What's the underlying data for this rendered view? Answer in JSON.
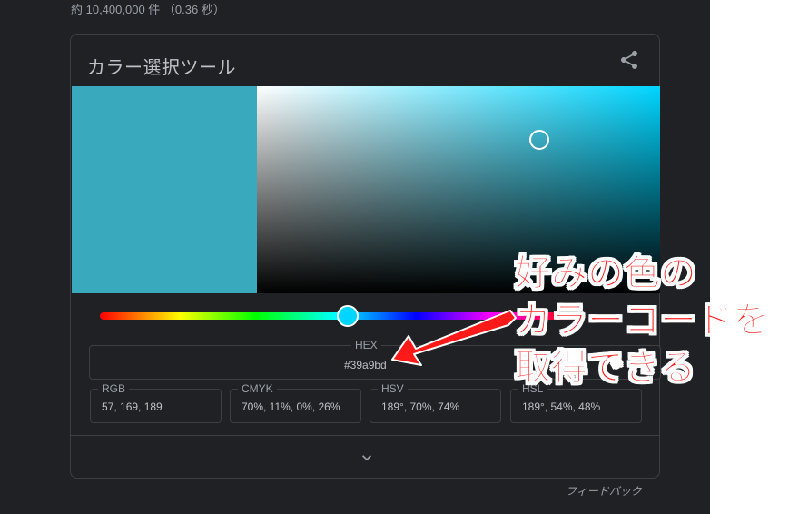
{
  "search": {
    "result_stats": "約 10,400,000 件 （0.36 秒）"
  },
  "color_picker": {
    "title": "カラー選択ツール",
    "color": "#39a9bd",
    "hue_color": "#00d5ff",
    "hue_degrees": 189,
    "saturation_percent": 70,
    "value_percent": 74,
    "hex": {
      "label": "HEX",
      "value": "#39a9bd"
    },
    "rgb": {
      "label": "RGB",
      "value": "57, 169, 189"
    },
    "cmyk": {
      "label": "CMYK",
      "value": "70%, 11%, 0%, 26%"
    },
    "hsv": {
      "label": "HSV",
      "value": "189°, 70%, 74%"
    },
    "hsl": {
      "label": "HSL",
      "value": "189°, 54%, 48%"
    },
    "icons": {
      "share": "share-icon",
      "expand": "chevron-down-icon"
    }
  },
  "feedback_label": "フィードバック",
  "annotation": {
    "lines": [
      "好みの色の",
      "カラーコードを",
      "取得できる"
    ],
    "color": "#ff1a1a"
  }
}
